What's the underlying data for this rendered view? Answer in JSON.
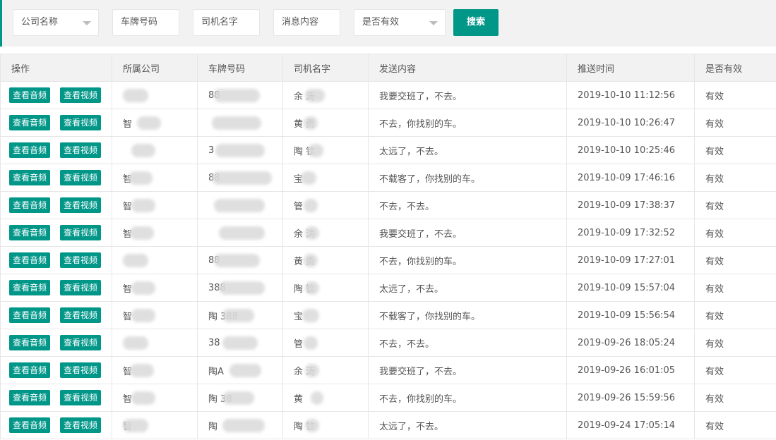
{
  "filters": {
    "company": "公司名称",
    "plate": "车牌号码",
    "driver": "司机名字",
    "message": "消息内容",
    "valid": "是否有效",
    "search_label": "搜索"
  },
  "table": {
    "headers": [
      "操作",
      "所属公司",
      "车牌号码",
      "司机名字",
      "发送内容",
      "推送时间",
      "是否有效"
    ],
    "audio_label": "查看音频",
    "video_label": "查看视频",
    "rows": [
      {
        "company": "",
        "plate": "88",
        "driver": "余 涛",
        "content": "我要交班了，不去。",
        "time": "2019-10-10 11:12:56",
        "valid": "有效"
      },
      {
        "company": "智",
        "plate": "",
        "driver": "黄 勇",
        "content": "不去，你找别的车。",
        "time": "2019-10-10 10:26:47",
        "valid": "有效"
      },
      {
        "company": "",
        "plate": "3",
        "driver": "陶 钦",
        "content": "太远了，不去。",
        "time": "2019-10-10 10:25:46",
        "valid": "有效"
      },
      {
        "company": "智",
        "plate": "88",
        "driver": "宝",
        "content": "不载客了，你找别的车。",
        "time": "2019-10-09 17:46:16",
        "valid": "有效"
      },
      {
        "company": "智",
        "plate": "",
        "driver": "管",
        "content": "不去，不去。",
        "time": "2019-10-09 17:38:37",
        "valid": "有效"
      },
      {
        "company": "智",
        "plate": "",
        "driver": "余 涛",
        "content": "我要交班了，不去。",
        "time": "2019-10-09 17:32:52",
        "valid": "有效"
      },
      {
        "company": "",
        "plate": "88",
        "driver": "黄 勇",
        "content": "不去，你找别的车。",
        "time": "2019-10-09 17:27:01",
        "valid": "有效"
      },
      {
        "company": "智",
        "plate": "388",
        "driver": "陶 钦",
        "content": "太远了，不去。",
        "time": "2019-10-09 15:57:04",
        "valid": "有效"
      },
      {
        "company": "智",
        "plate": "陶 388",
        "driver": "宝",
        "content": "不载客了，你找别的车。",
        "time": "2019-10-09 15:56:54",
        "valid": "有效"
      },
      {
        "company": "",
        "plate": "38",
        "driver": "管",
        "content": "不去，不去。",
        "time": "2019-09-26 18:05:24",
        "valid": "有效"
      },
      {
        "company": "智",
        "plate": "陶A",
        "driver": "余 涛",
        "content": "我要交班了，不去。",
        "time": "2019-09-26 16:01:05",
        "valid": "有效"
      },
      {
        "company": "智",
        "plate": "陶 38",
        "driver": "黄",
        "content": "不去，你找别的车。",
        "time": "2019-09-26 15:59:56",
        "valid": "有效"
      },
      {
        "company": "智",
        "plate": "陶",
        "driver": "陶 钦",
        "content": "太远了，不去。",
        "time": "2019-09-24 17:05:14",
        "valid": "有效"
      }
    ]
  },
  "colors": {
    "accent": "#009688",
    "header_bg": "#f2f2f2",
    "border": "#e6e6e6"
  }
}
